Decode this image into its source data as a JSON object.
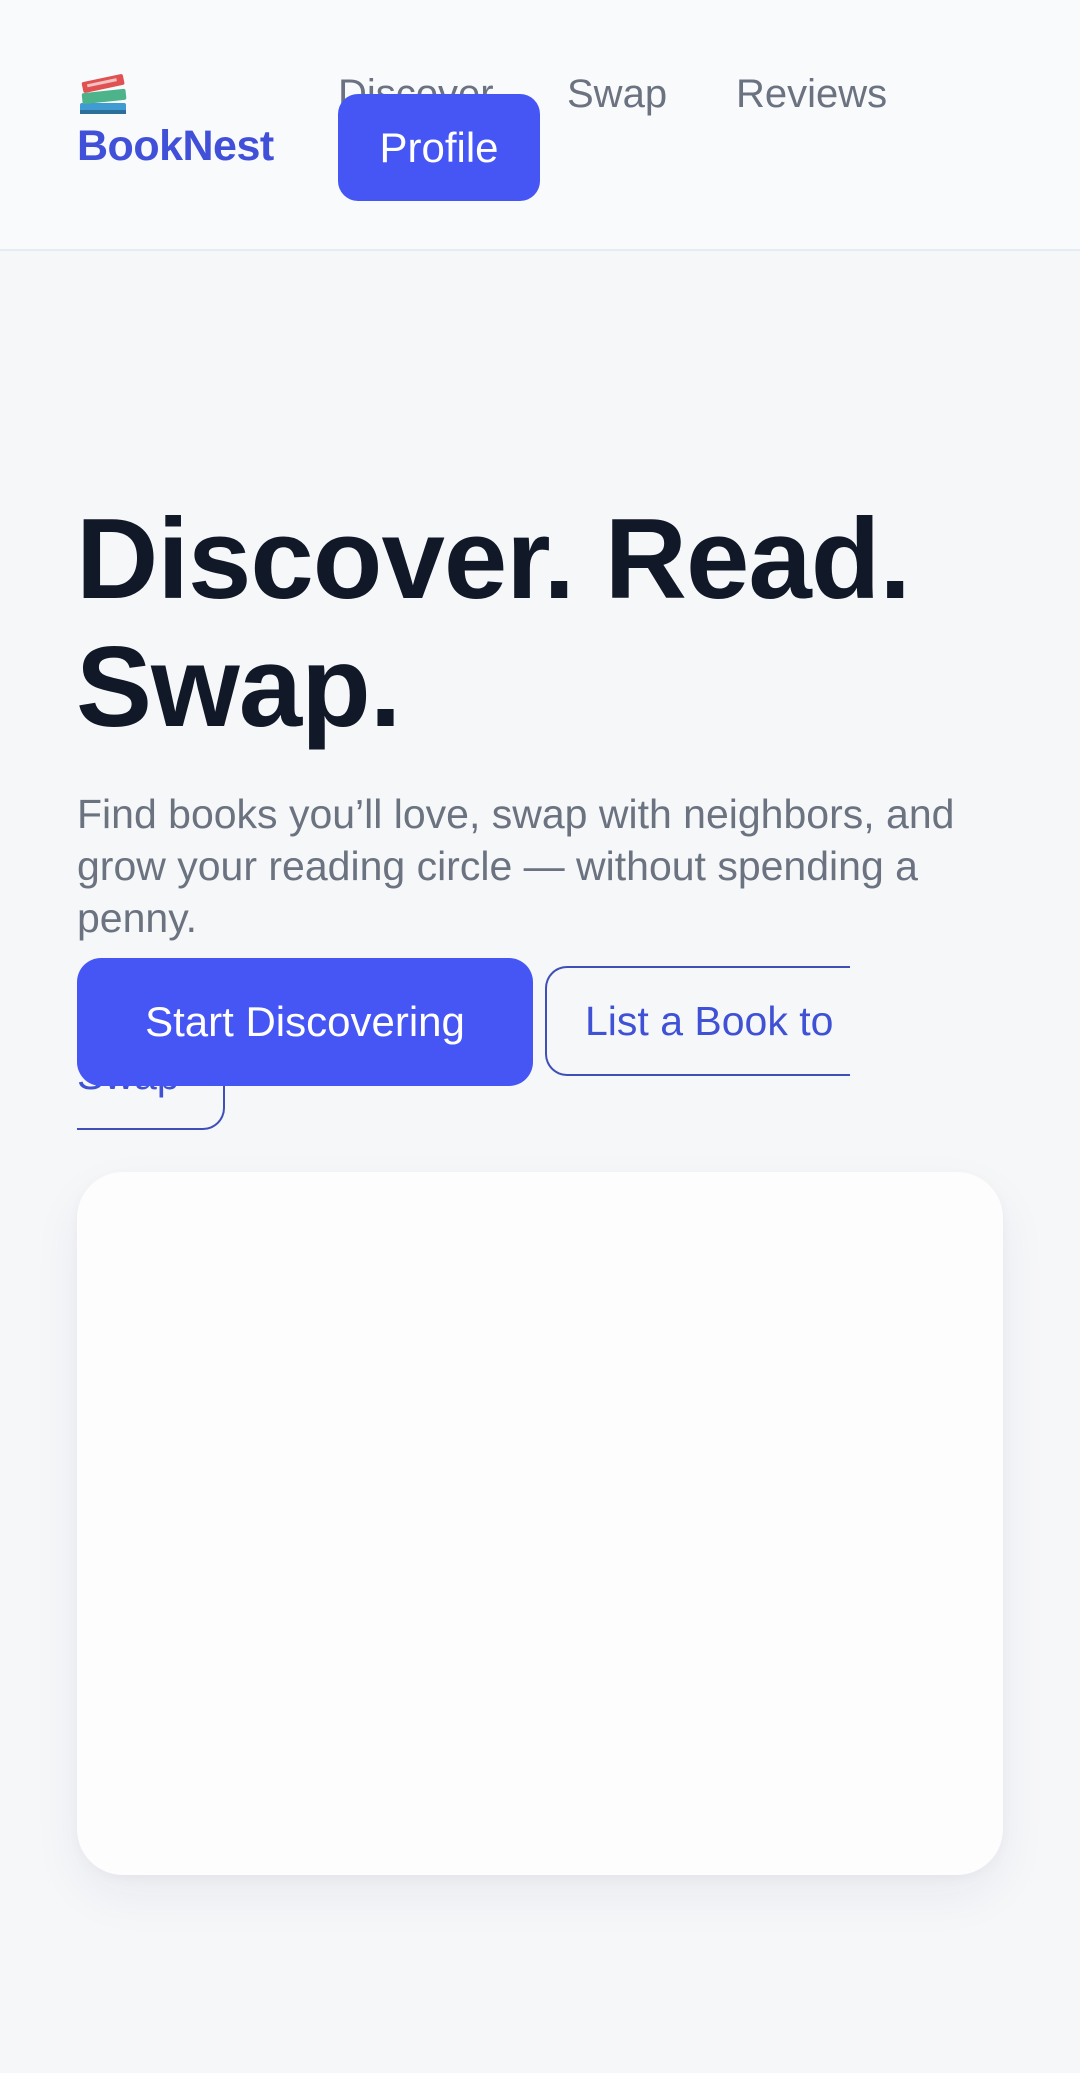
{
  "header": {
    "logo_icon": "books-icon",
    "brand": "BookNest",
    "nav": {
      "discover": "Discover",
      "swap": "Swap",
      "reviews": "Reviews",
      "profile": "Profile"
    }
  },
  "hero": {
    "title": "Discover. Read. Swap.",
    "subtitle": "Find books you’ll love, swap with neighbors, and grow your reading circle — without spending a penny.",
    "primary_cta": "Start Discovering",
    "secondary_cta": "List a Book to Swap",
    "secondary_cta_line1": "List a Book to",
    "secondary_cta_line2": "Swap"
  },
  "colors": {
    "accent": "#4656f5",
    "brand": "#4150d8",
    "heading": "#111827",
    "muted": "#6b7280",
    "background": "#f6f7f9"
  }
}
